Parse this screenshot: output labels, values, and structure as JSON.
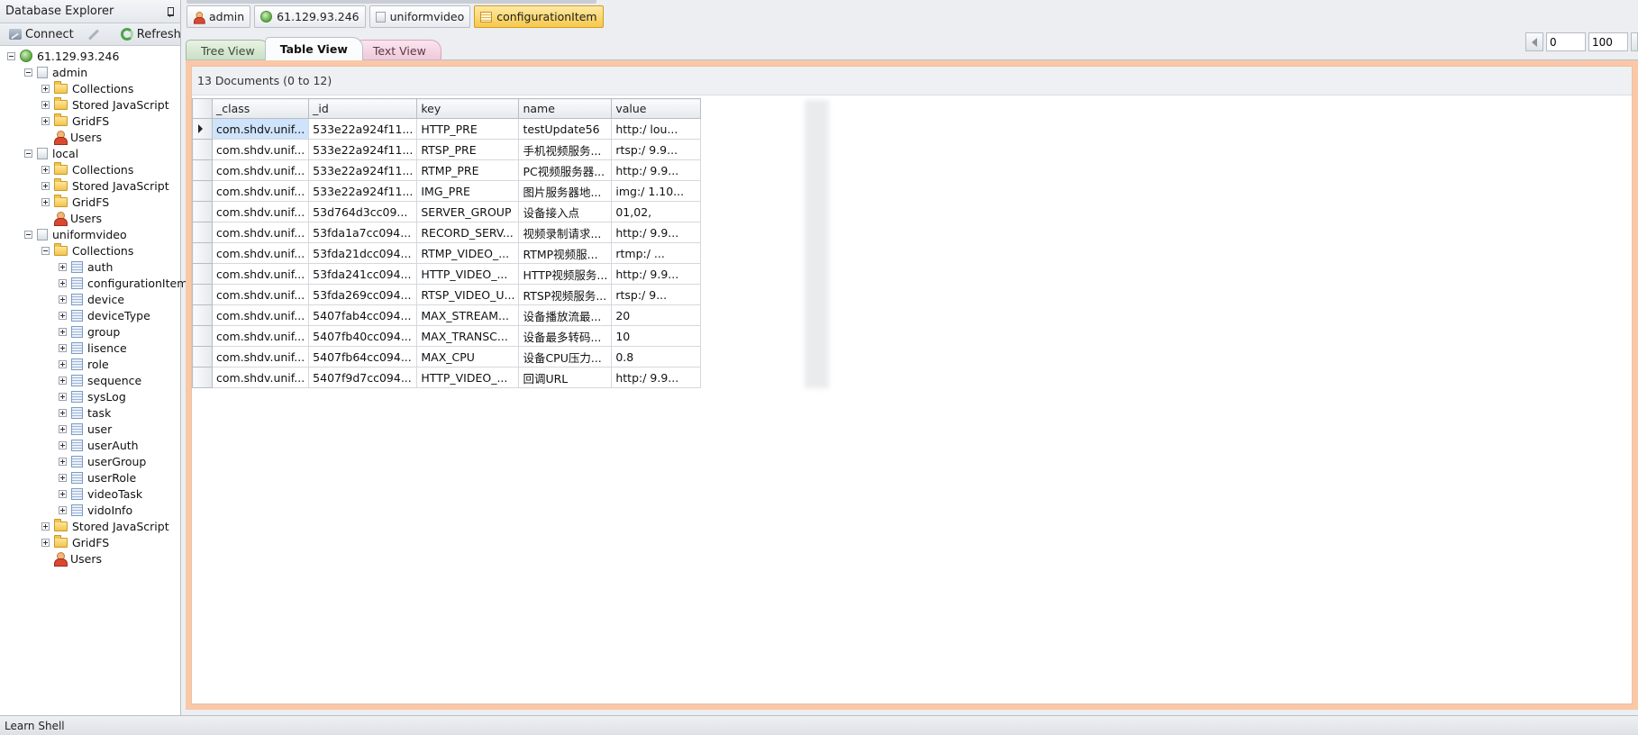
{
  "explorer": {
    "title": "Database Explorer",
    "toolbar": {
      "connect_label": "Connect",
      "refresh_label": "Refresh"
    },
    "tree": [
      {
        "level": 0,
        "type": "server",
        "label": "61.129.93.246",
        "expander": "minus"
      },
      {
        "level": 1,
        "type": "db",
        "label": "admin",
        "expander": "minus"
      },
      {
        "level": 2,
        "type": "folder",
        "label": "Collections",
        "expander": "plus"
      },
      {
        "level": 2,
        "type": "folder",
        "label": "Stored JavaScript",
        "expander": "plus"
      },
      {
        "level": 2,
        "type": "folder",
        "label": "GridFS",
        "expander": "plus"
      },
      {
        "level": 2,
        "type": "users",
        "label": "Users",
        "expander": "none"
      },
      {
        "level": 1,
        "type": "db",
        "label": "local",
        "expander": "minus"
      },
      {
        "level": 2,
        "type": "folder",
        "label": "Collections",
        "expander": "plus"
      },
      {
        "level": 2,
        "type": "folder",
        "label": "Stored JavaScript",
        "expander": "plus"
      },
      {
        "level": 2,
        "type": "folder",
        "label": "GridFS",
        "expander": "plus"
      },
      {
        "level": 2,
        "type": "users",
        "label": "Users",
        "expander": "none"
      },
      {
        "level": 1,
        "type": "db",
        "label": "uniformvideo",
        "expander": "minus"
      },
      {
        "level": 2,
        "type": "folder",
        "label": "Collections",
        "expander": "minus"
      },
      {
        "level": 3,
        "type": "collection",
        "label": "auth",
        "expander": "plus"
      },
      {
        "level": 3,
        "type": "collection",
        "label": "configurationItem",
        "expander": "plus"
      },
      {
        "level": 3,
        "type": "collection",
        "label": "device",
        "expander": "plus"
      },
      {
        "level": 3,
        "type": "collection",
        "label": "deviceType",
        "expander": "plus"
      },
      {
        "level": 3,
        "type": "collection",
        "label": "group",
        "expander": "plus"
      },
      {
        "level": 3,
        "type": "collection",
        "label": "lisence",
        "expander": "plus"
      },
      {
        "level": 3,
        "type": "collection",
        "label": "role",
        "expander": "plus"
      },
      {
        "level": 3,
        "type": "collection",
        "label": "sequence",
        "expander": "plus"
      },
      {
        "level": 3,
        "type": "collection",
        "label": "sysLog",
        "expander": "plus"
      },
      {
        "level": 3,
        "type": "collection",
        "label": "task",
        "expander": "plus"
      },
      {
        "level": 3,
        "type": "collection",
        "label": "user",
        "expander": "plus"
      },
      {
        "level": 3,
        "type": "collection",
        "label": "userAuth",
        "expander": "plus"
      },
      {
        "level": 3,
        "type": "collection",
        "label": "userGroup",
        "expander": "plus"
      },
      {
        "level": 3,
        "type": "collection",
        "label": "userRole",
        "expander": "plus"
      },
      {
        "level": 3,
        "type": "collection",
        "label": "videoTask",
        "expander": "plus"
      },
      {
        "level": 3,
        "type": "collection",
        "label": "vidoInfo",
        "expander": "plus"
      },
      {
        "level": 2,
        "type": "folder",
        "label": "Stored JavaScript",
        "expander": "plus"
      },
      {
        "level": 2,
        "type": "folder",
        "label": "GridFS",
        "expander": "plus"
      },
      {
        "level": 2,
        "type": "users",
        "label": "Users",
        "expander": "none"
      }
    ]
  },
  "breadcrumb": [
    {
      "label": "admin",
      "icon": "user-icon",
      "active": false
    },
    {
      "label": "61.129.93.246",
      "icon": "server-icon",
      "active": false
    },
    {
      "label": "uniformvideo",
      "icon": "database-icon",
      "active": false
    },
    {
      "label": "configurationItem",
      "icon": "collection-icon",
      "active": true
    }
  ],
  "tabs": [
    {
      "label": "Tree View",
      "style": "tree",
      "active": false
    },
    {
      "label": "Table View",
      "style": "table",
      "active": true
    },
    {
      "label": "Text View",
      "style": "text",
      "active": false
    }
  ],
  "paging": {
    "skip": "0",
    "limit": "100"
  },
  "result": {
    "summary": "13 Documents (0 to 12)",
    "columns": [
      "_class",
      "_id",
      "key",
      "name",
      "value"
    ],
    "rows": [
      [
        "com.shdv.unif...",
        "533e22a924f11...",
        "HTTP_PRE",
        "testUpdate56",
        "http:/      lou..."
      ],
      [
        "com.shdv.unif...",
        "533e22a924f11...",
        "RTSP_PRE",
        "手机视频服务...",
        "rtsp:/      9.9..."
      ],
      [
        "com.shdv.unif...",
        "533e22a924f11...",
        "RTMP_PRE",
        "PC视频服务器...",
        "http:/      9.9..."
      ],
      [
        "com.shdv.unif...",
        "533e22a924f11...",
        "IMG_PRE",
        "图片服务器地...",
        "img:/      1.10..."
      ],
      [
        "com.shdv.unif...",
        "53d764d3cc09...",
        "SERVER_GROUP",
        "设备接入点",
        "01,02,"
      ],
      [
        "com.shdv.unif...",
        "53fda1a7cc094...",
        "RECORD_SERV...",
        "视频录制请求...",
        "http:/      9.9..."
      ],
      [
        "com.shdv.unif...",
        "53fda21dcc094...",
        "RTMP_VIDEO_...",
        "RTMP视频服...",
        "rtmp:/      ..."
      ],
      [
        "com.shdv.unif...",
        "53fda241cc094...",
        "HTTP_VIDEO_...",
        "HTTP视频服务...",
        "http:/      9.9..."
      ],
      [
        "com.shdv.unif...",
        "53fda269cc094...",
        "RTSP_VIDEO_U...",
        "RTSP视频服务...",
        "rtsp:/      9..."
      ],
      [
        "com.shdv.unif...",
        "5407fab4cc094...",
        "MAX_STREAM...",
        "设备播放流最...",
        "20"
      ],
      [
        "com.shdv.unif...",
        "5407fb40cc094...",
        "MAX_TRANSC...",
        "设备最多转码...",
        "10"
      ],
      [
        "com.shdv.unif...",
        "5407fb64cc094...",
        "MAX_CPU",
        "设备CPU压力...",
        "0.8"
      ],
      [
        "com.shdv.unif...",
        "5407f9d7cc094...",
        "HTTP_VIDEO_...",
        "回调URL",
        "http:/      9.9..."
      ]
    ]
  },
  "statusbar": {
    "text": "Learn Shell"
  }
}
